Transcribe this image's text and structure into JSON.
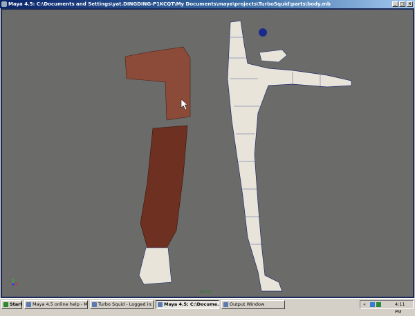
{
  "window": {
    "title": "Maya 4.5: C:\\Documents and Settings\\yat.DINGDING-P1KCQT\\My Documents\\maya\\projects\\TurboSquid\\parts\\body.mb",
    "minimize": "_",
    "maximize": "□",
    "close": "×"
  },
  "viewport": {
    "camera_label": "persp",
    "axis_labels": {
      "y": "y",
      "z": "z",
      "x": "x"
    }
  },
  "taskbar": {
    "start_label": "Start",
    "items": [
      {
        "label": "Maya 4.5 online help - Mi...",
        "active": false
      },
      {
        "label": "Turbo Squid - Logged in:...",
        "active": false
      },
      {
        "label": "Maya 4.5: C:\\Docume...",
        "active": true
      },
      {
        "label": "Output Window",
        "active": false
      }
    ],
    "tray_expand": "«",
    "clock": "4:11 PM"
  }
}
